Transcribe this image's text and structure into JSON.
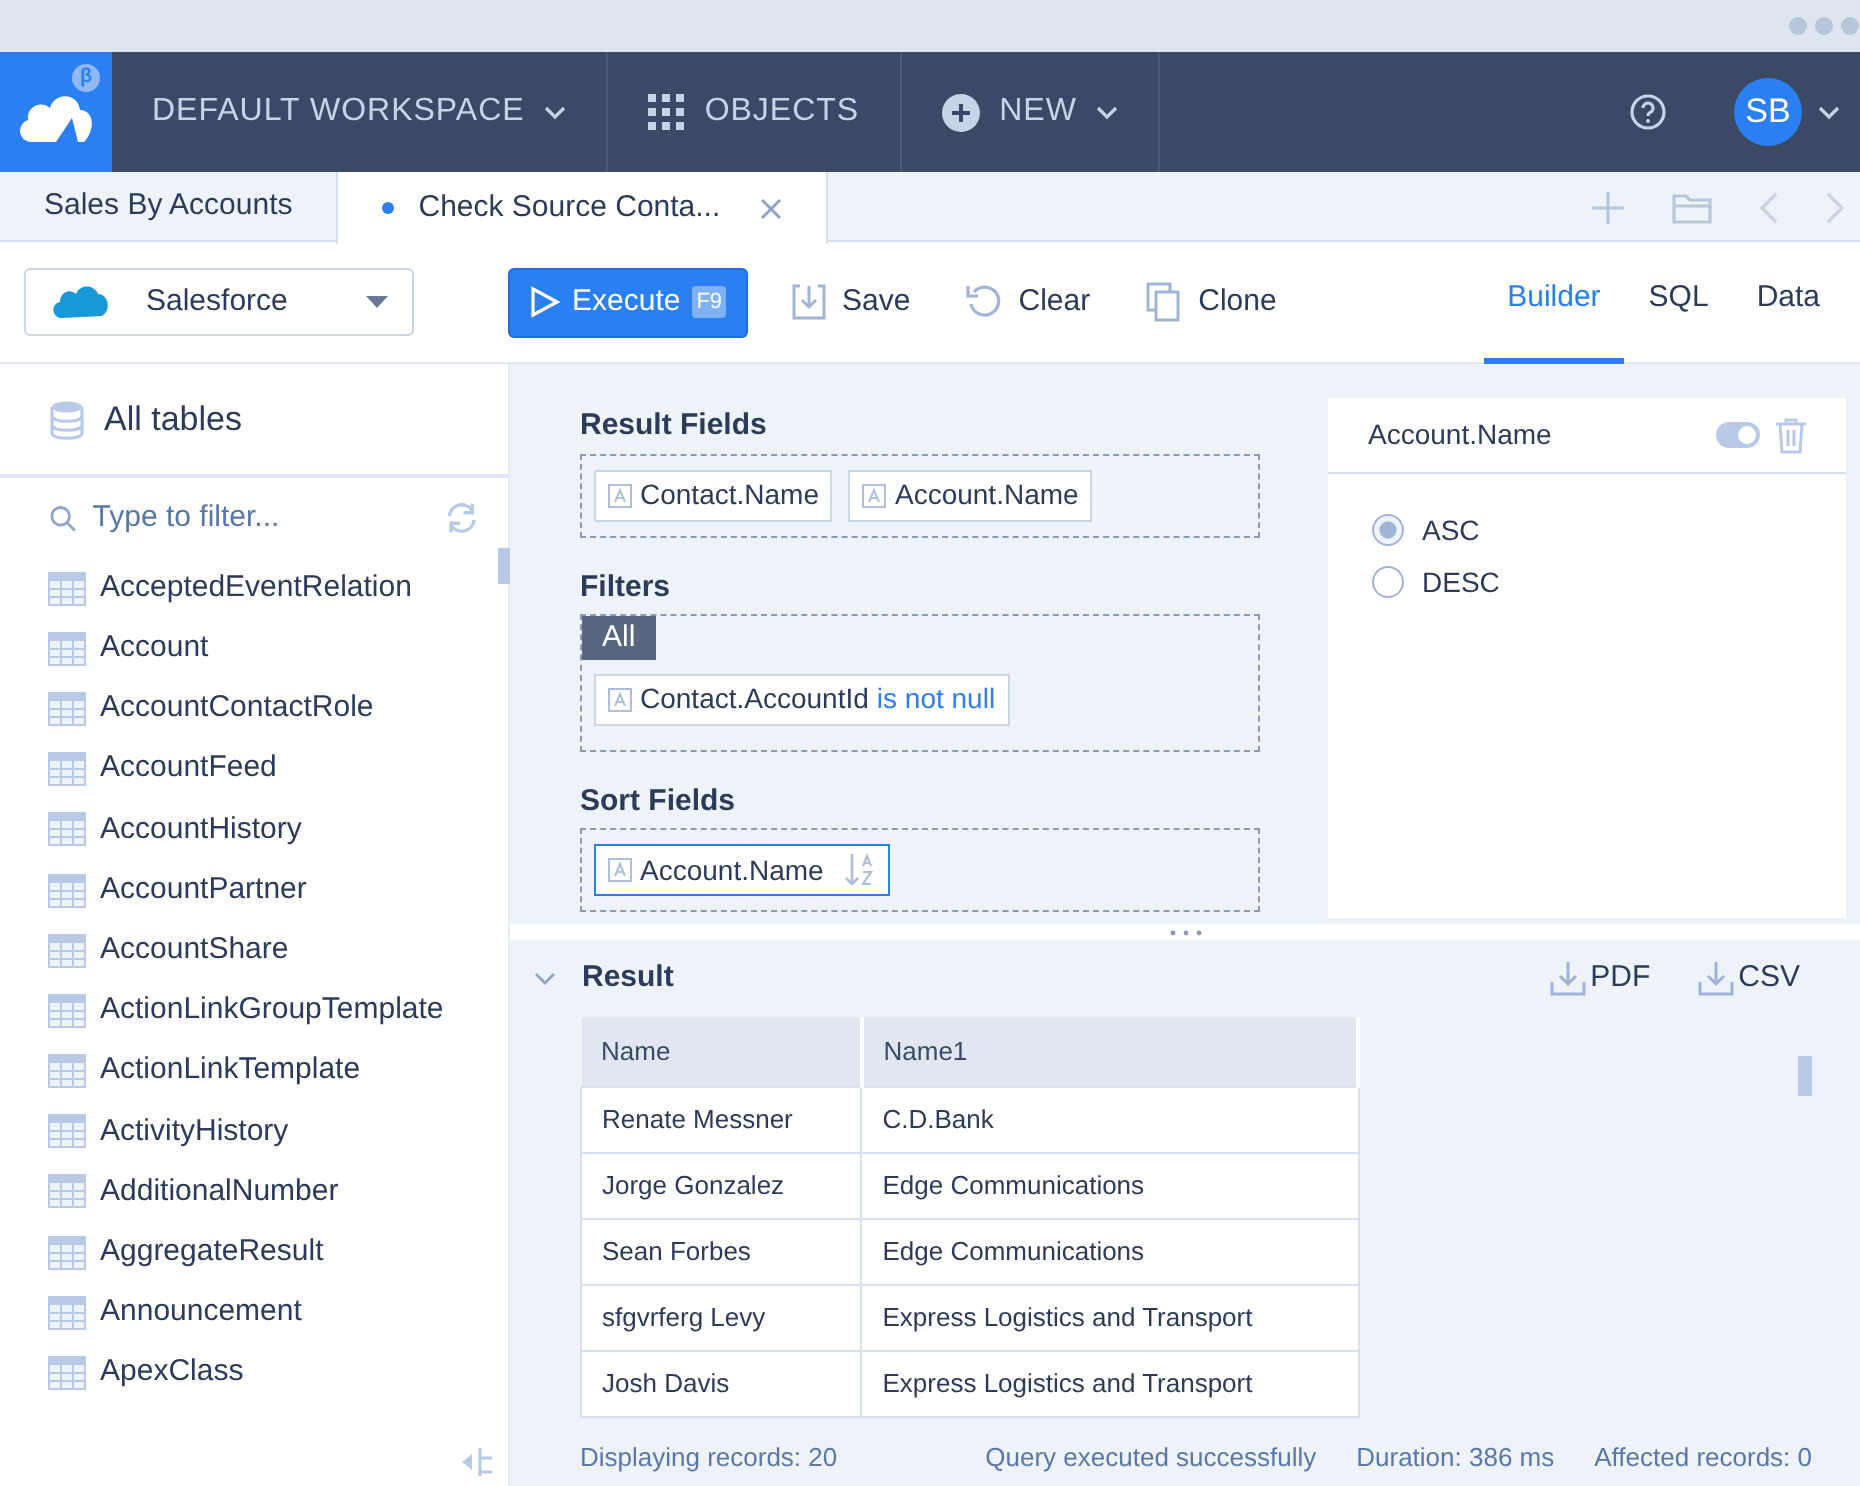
{
  "topnav": {
    "beta_badge": "β",
    "workspace": "DEFAULT WORKSPACE",
    "objects": "OBJECTS",
    "new": "NEW",
    "avatar": "SB"
  },
  "doc_tabs": [
    {
      "label": "Sales By Accounts",
      "selected": false,
      "modified": false
    },
    {
      "label": "Check Source Conta...",
      "selected": true,
      "modified": true
    }
  ],
  "source": {
    "label": "Salesforce"
  },
  "toolbar": {
    "execute": "Execute",
    "shortcut": "F9",
    "save": "Save",
    "clear": "Clear",
    "clone": "Clone"
  },
  "view_tabs": [
    {
      "label": "Builder",
      "selected": true
    },
    {
      "label": "SQL",
      "selected": false
    },
    {
      "label": "Data",
      "selected": false
    }
  ],
  "sidebar": {
    "title": "All tables",
    "filter": {
      "placeholder": "Type to filter..."
    },
    "tables": [
      "AcceptedEventRelation",
      "Account",
      "AccountContactRole",
      "AccountFeed",
      "AccountHistory",
      "AccountPartner",
      "AccountShare",
      "ActionLinkGroupTemplate",
      "ActionLinkTemplate",
      "ActivityHistory",
      "AdditionalNumber",
      "AggregateResult",
      "Announcement",
      "ApexClass"
    ]
  },
  "builder": {
    "result_fields": {
      "title": "Result Fields",
      "items": [
        "Contact.Name",
        "Account.Name"
      ]
    },
    "filters": {
      "title": "Filters",
      "group": "All",
      "conditions": [
        {
          "field": "Contact.AccountId",
          "operator": "is not null"
        }
      ]
    },
    "sort_fields": {
      "title": "Sort Fields",
      "items": [
        {
          "field": "Account.Name",
          "selected": true
        }
      ]
    }
  },
  "sort_panel": {
    "field": "Account.Name",
    "on": true,
    "options": [
      {
        "label": "ASC",
        "selected": true
      },
      {
        "label": "DESC",
        "selected": false
      }
    ]
  },
  "result": {
    "title": "Result",
    "exports": [
      "PDF",
      "CSV"
    ],
    "columns": [
      "Name",
      "Name1"
    ],
    "rows": [
      [
        "Renate Messner",
        "C.D.Bank"
      ],
      [
        "Jorge Gonzalez",
        "Edge Communications"
      ],
      [
        "Sean Forbes",
        "Edge Communications"
      ],
      [
        "sfgvrferg Levy",
        "Express Logistics and Transport"
      ],
      [
        "Josh Davis",
        "Express Logistics and Transport"
      ]
    ],
    "status": {
      "displaying": "Displaying records: 20",
      "message": "Query executed successfully",
      "duration": "Duration: 386 ms",
      "affected": "Affected records: 0"
    }
  }
}
